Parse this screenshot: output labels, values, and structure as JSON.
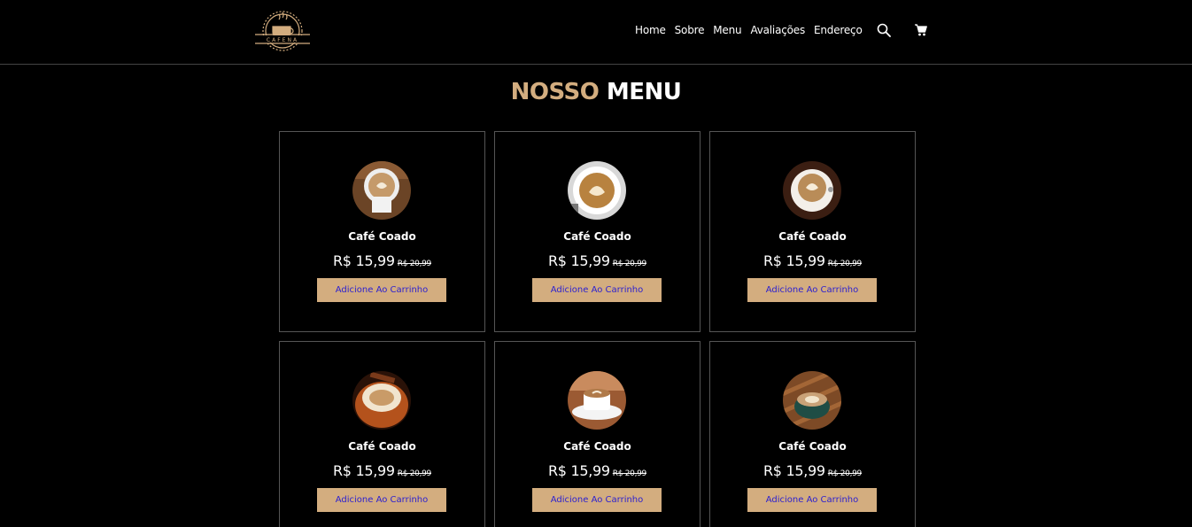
{
  "header": {
    "logo_text": "CAFENA",
    "nav": [
      {
        "label": "Home"
      },
      {
        "label": "Sobre"
      },
      {
        "label": "Menu"
      },
      {
        "label": "Avaliações"
      },
      {
        "label": "Endereço"
      }
    ]
  },
  "menu": {
    "title_accent": "NOSSO",
    "title_rest": "MENU",
    "items": [
      {
        "name": "Café Coado",
        "price": "R$ 15,99",
        "old_price": "R$ 20,99",
        "button": "Adicione Ao Carrinho"
      },
      {
        "name": "Café Coado",
        "price": "R$ 15,99",
        "old_price": "R$ 20,99",
        "button": "Adicione Ao Carrinho"
      },
      {
        "name": "Café Coado",
        "price": "R$ 15,99",
        "old_price": "R$ 20,99",
        "button": "Adicione Ao Carrinho"
      },
      {
        "name": "Café Coado",
        "price": "R$ 15,99",
        "old_price": "R$ 20,99",
        "button": "Adicione Ao Carrinho"
      },
      {
        "name": "Café Coado",
        "price": "R$ 15,99",
        "old_price": "R$ 20,99",
        "button": "Adicione Ao Carrinho"
      },
      {
        "name": "Café Coado",
        "price": "R$ 15,99",
        "old_price": "R$ 20,99",
        "button": "Adicione Ao Carrinho"
      }
    ]
  },
  "colors": {
    "background": "#000000",
    "accent": "#d3ad7f",
    "button_text": "#2a1fd1",
    "border": "#555555"
  },
  "icons": [
    "search-icon",
    "cart-icon"
  ]
}
